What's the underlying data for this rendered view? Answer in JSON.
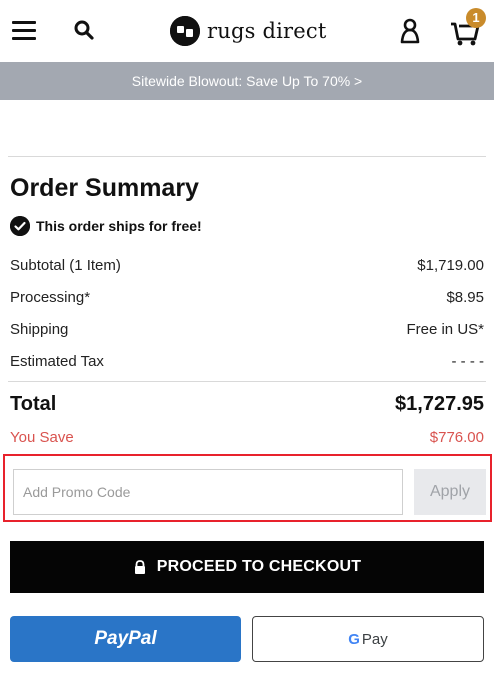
{
  "header": {
    "brand": "rugs direct",
    "cart_count": "1"
  },
  "promo_banner": {
    "text": "Sitewide Blowout: Save Up To 70% >"
  },
  "summary": {
    "title": "Order Summary",
    "free_shipping": "This order ships for free!",
    "lines": [
      {
        "label": "Subtotal (1 Item)",
        "value": "$1,719.00"
      },
      {
        "label": "Processing*",
        "value": "$8.95"
      },
      {
        "label": "Shipping",
        "value": "Free in US*"
      },
      {
        "label": "Estimated Tax",
        "value": "- - - -"
      }
    ],
    "total": {
      "label": "Total",
      "value": "$1,727.95"
    },
    "savings": {
      "label": "You Save",
      "value": "$776.00"
    }
  },
  "promo_code": {
    "placeholder": "Add Promo Code",
    "value": "",
    "apply_label": "Apply"
  },
  "checkout": {
    "label": "PROCEED TO CHECKOUT"
  },
  "payments": {
    "paypal_label": "PayPal",
    "gpay_g": "G",
    "gpay_label": "Pay"
  },
  "colors": {
    "banner_bg": "#a3a8b1",
    "savings_red": "#d9534f",
    "highlight_red": "#e8222c",
    "paypal_blue": "#2a75c7",
    "cart_badge": "#c98b2b"
  },
  "icons": {
    "menu": "hamburger-menu-icon",
    "search": "search-icon",
    "account": "account-icon",
    "cart": "cart-icon",
    "check": "checkmark-circle-icon",
    "lock": "lock-icon",
    "logo": "rugs-direct-logo-icon"
  }
}
